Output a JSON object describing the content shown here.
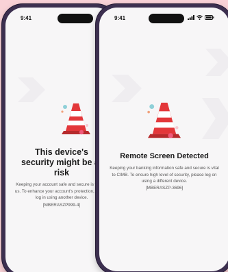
{
  "phones": [
    {
      "time": "9:41",
      "title": "This device's security might be at risk",
      "description": "Keeping your account safe and secure is vital to us. To enhance your account's protection, please log in using another device.",
      "code": "[MBERASZP999-4]"
    },
    {
      "time": "9:41",
      "title": "Remote Screen Detected",
      "description": "Keeping your banking information safe and secure is vital to CIMB. To ensure high level of security, please log on using a different device.",
      "code": "[MBERASZP-3696]"
    }
  ],
  "illustration": "traffic-cone-icon",
  "colors": {
    "background": "#f9d2d7",
    "frame": "#3c2f4f",
    "screen": "#f7f6f7",
    "cone": "#e3373a"
  }
}
